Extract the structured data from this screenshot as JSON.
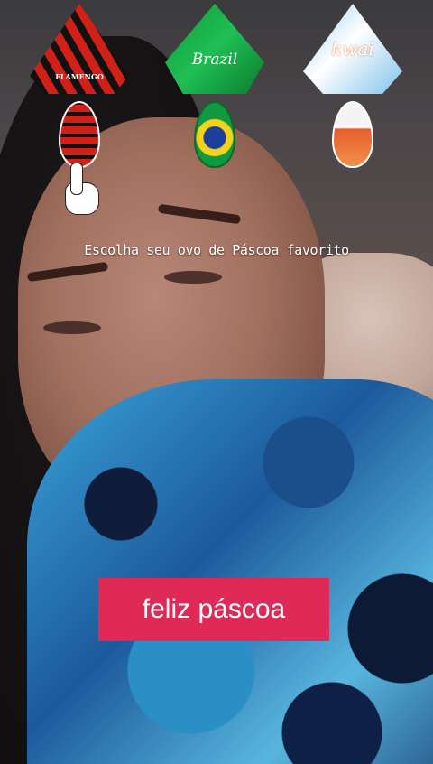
{
  "scene": {
    "prompt_text": "Escolha seu ovo de Páscoa favorito",
    "caption_text": "feliz páscoa",
    "caption_color": "#df2a57"
  },
  "eggs": [
    {
      "name": "flamengo",
      "label": "FLAMENGO",
      "icon": "flamengo-easter-egg-icon"
    },
    {
      "name": "brazil",
      "label": "Brazil",
      "icon": "brazil-easter-egg-icon"
    },
    {
      "name": "kwai",
      "label": "kwai",
      "icon": "kwai-easter-egg-icon"
    }
  ],
  "pointer": {
    "icon": "pointing-hand-icon"
  }
}
